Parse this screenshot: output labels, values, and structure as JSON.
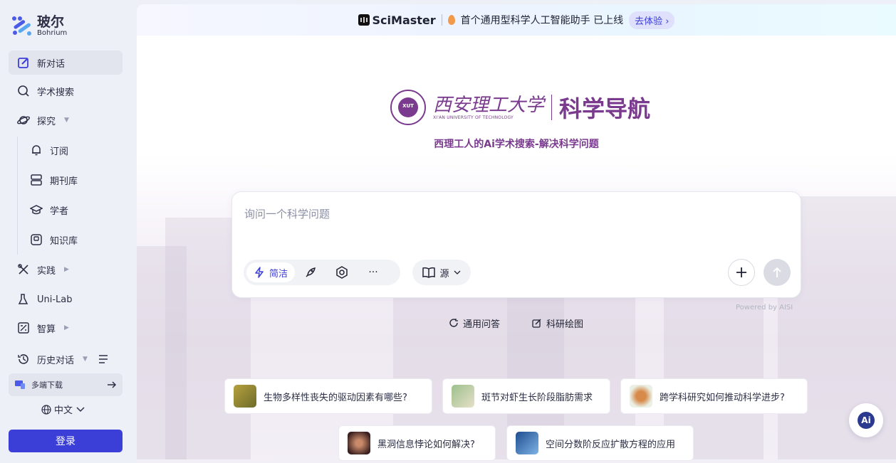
{
  "brand": {
    "name_cn": "玻尔",
    "name_en": "Bohrium"
  },
  "sidebar": {
    "new_chat": "新对话",
    "search": "学术搜索",
    "explore": "探究",
    "sub_items": [
      {
        "label": "订阅",
        "icon": "bell-icon"
      },
      {
        "label": "期刊库",
        "icon": "database-icon"
      },
      {
        "label": "学者",
        "icon": "graduation-cap-icon"
      },
      {
        "label": "知识库",
        "icon": "knowledge-base-icon"
      }
    ],
    "practice": "实践",
    "unilab": "Uni-Lab",
    "compute": "智算",
    "history": "历史对话",
    "download": "多端下载",
    "language": "中文",
    "login": "登录"
  },
  "banner": {
    "product": "SciMaster",
    "text": "首个通用型科学人工智能助手  已上线",
    "cta": "去体验"
  },
  "hero": {
    "university_cn": "西安理工大学",
    "university_en": "XI'AN UNIVERSITY OF TECHNOLOGY",
    "seal_text": "XUT",
    "title": "科学导航",
    "subtitle": "西理工人的Ai学术搜索-解决科学问题"
  },
  "chat": {
    "placeholder": "询问一个科学问题",
    "mode_active": "简洁",
    "source": "源",
    "powered_by": "Powered by AISI"
  },
  "chips": [
    "通用问答",
    "科研绘图"
  ],
  "suggestions": [
    "生物多样性丧失的驱动因素有哪些?",
    "斑节对虾生长阶段脂肪需求",
    "跨学科研究如何推动科学进步?",
    "黑洞信息悖论如何解决?",
    "空间分数阶反应扩散方程的应用"
  ],
  "fab": {
    "label": "Ai"
  },
  "colors": {
    "accent": "#3b3fd8",
    "university_purple": "#7a3b8f"
  }
}
